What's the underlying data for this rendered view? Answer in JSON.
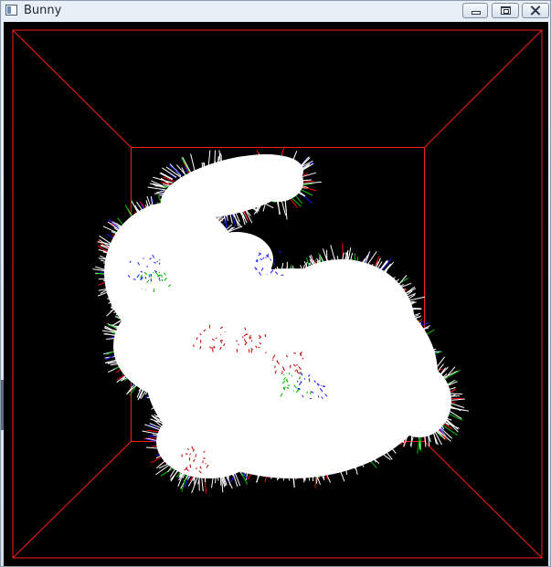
{
  "window": {
    "title": "Bunny",
    "icon": "app-window-icon"
  },
  "controls": {
    "minimize": "minimize-icon",
    "maximize": "restore-icon",
    "close": "close-icon"
  },
  "scene": {
    "background_color": "#000000",
    "box_color": "#ff1a1a",
    "model_color": "#ffffff",
    "normal_colors": [
      "#ff0000",
      "#00c000",
      "#1a1aff"
    ]
  }
}
